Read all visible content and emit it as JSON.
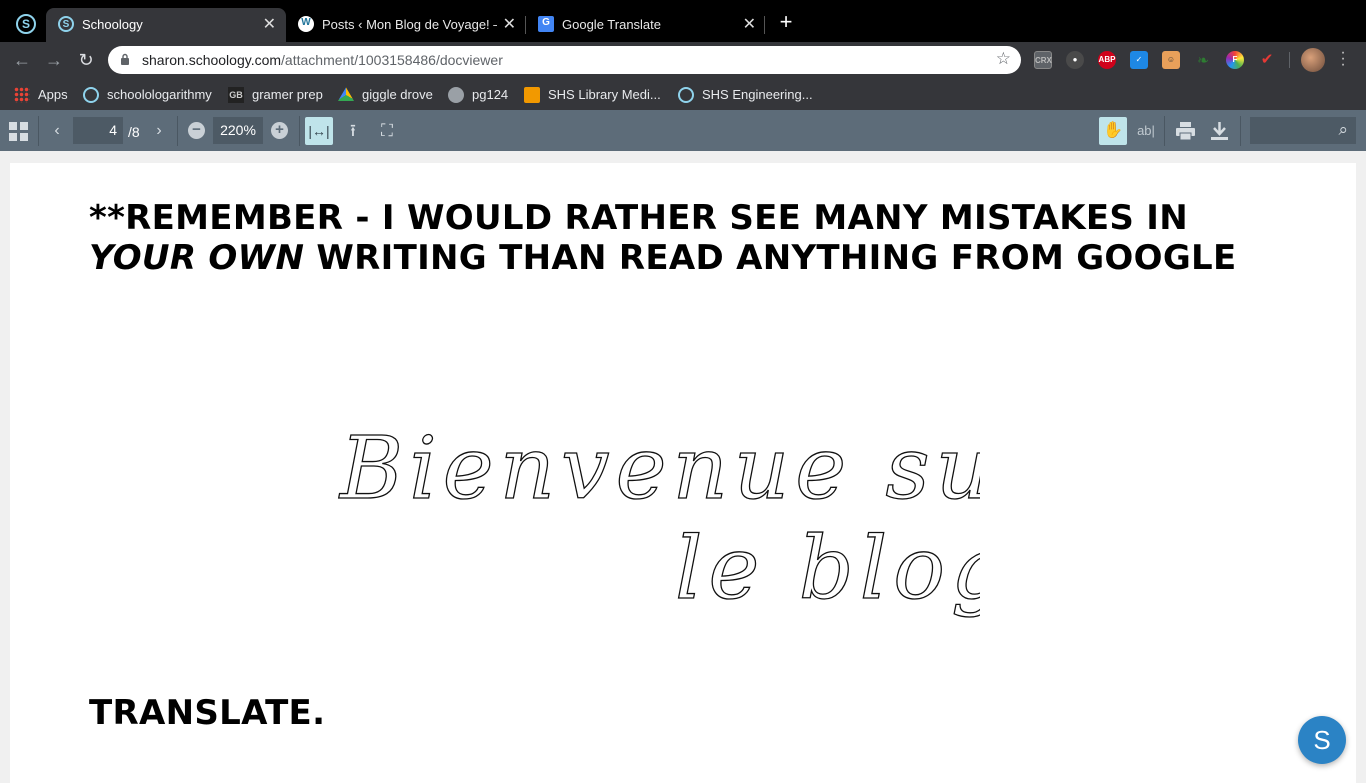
{
  "browser": {
    "tabs": [
      {
        "label": "Schoology",
        "icon": "schoology-icon",
        "active": true
      },
      {
        "label": "Posts ‹ Mon Blog de Voyage! —",
        "icon": "wordpress-icon",
        "active": false
      },
      {
        "label": "Google Translate",
        "icon": "google-translate-icon",
        "active": false
      }
    ],
    "url_host": "sharon.schoology.com",
    "url_path": "/attachment/1003158486/docviewer",
    "extensions": [
      "CRX",
      "ABP"
    ],
    "bookmarks": [
      {
        "label": "Apps",
        "icon": "apps-grid-icon"
      },
      {
        "label": "schoolologarithmy",
        "icon": "schoology-icon"
      },
      {
        "label": "gramer prep",
        "icon": "gb-icon"
      },
      {
        "label": "giggle drove",
        "icon": "google-drive-icon"
      },
      {
        "label": "pg124",
        "icon": "globe-icon"
      },
      {
        "label": "SHS Library Medi...",
        "icon": "library-icon"
      },
      {
        "label": "SHS Engineering...",
        "icon": "schoology-icon"
      }
    ]
  },
  "viewer": {
    "current_page": "4",
    "total_pages": "/8",
    "zoom": "220%"
  },
  "document": {
    "heading_part1": "**REMEMBER  - I WOULD RATHER SEE MANY MISTAKES IN",
    "heading_italic": "YOUR OWN",
    "heading_part2": " WRITING THAN READ ANYTHING FROM GOOGLE",
    "script_line1": "Bienvenue sur",
    "script_line2": "le blog",
    "footer_text": "TRANSLATE."
  },
  "help_button": "S",
  "colors": {
    "chrome_dark": "#35363a",
    "viewer_bar": "#5d6c79",
    "schoology_blue": "#2b83c5"
  }
}
